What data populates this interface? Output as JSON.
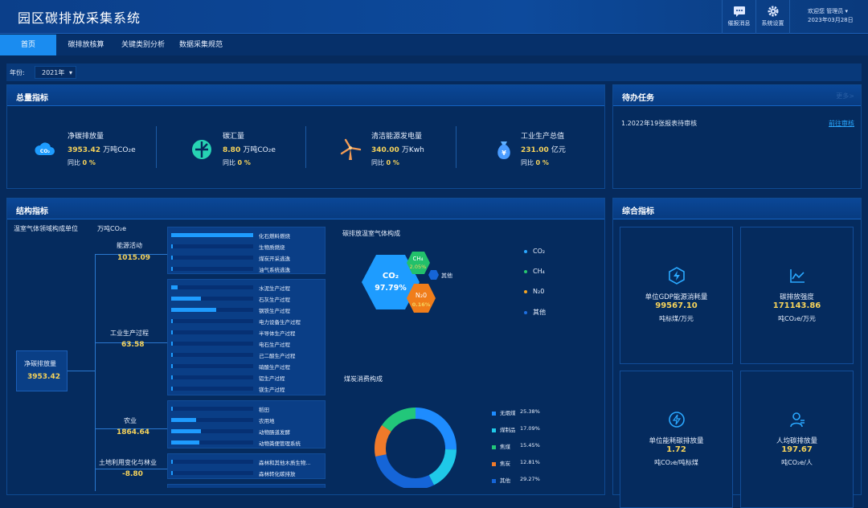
{
  "header": {
    "title": "园区碳排放采集系统",
    "todo_msg_label": "催报消息",
    "settings_label": "系统设置",
    "welcome": "欢迎您",
    "user": "管理员",
    "date": "2023年03月28日"
  },
  "nav": {
    "tabs": [
      "首页",
      "碳排放核算",
      "关键类别分析",
      "数据采集规范"
    ]
  },
  "filter": {
    "year_label": "年份:",
    "year_value": "2021年"
  },
  "total": {
    "title": "总量指标",
    "items": [
      {
        "icon": "co2-cloud-icon",
        "label": "净碳排放量",
        "value": "3953.42",
        "unit": "万吨CO₂e",
        "yoy_label": "同比",
        "yoy": "0 %"
      },
      {
        "icon": "carbon-sink-icon",
        "label": "碳汇量",
        "value": "8.80",
        "unit": "万吨CO₂e",
        "yoy_label": "同比",
        "yoy": "0 %"
      },
      {
        "icon": "wind-turbine-icon",
        "label": "清洁能源发电量",
        "value": "340.00",
        "unit": "万Kwh",
        "yoy_label": "同比",
        "yoy": "0 %"
      },
      {
        "icon": "money-bag-icon",
        "label": "工业生产总值",
        "value": "231.00",
        "unit": "亿元",
        "yoy_label": "同比",
        "yoy": "0 %"
      }
    ]
  },
  "todo": {
    "title": "待办任务",
    "more": "更多>",
    "items": [
      {
        "text": "1.2022年19张报表待审核",
        "action": "前往审核"
      }
    ]
  },
  "structure": {
    "title": "结构指标",
    "caption": "温室气体领域构成单位",
    "unit": "万吨CO₂e",
    "root": {
      "label": "净碳排放量",
      "value": "3953.42"
    },
    "groups": [
      {
        "label": "能源活动",
        "value": "1015.09",
        "bars": [
          {
            "label": "化石燃料燃烧",
            "v": 1.0
          },
          {
            "label": "生物质燃烧",
            "v": 0.0
          },
          {
            "label": "煤炭开采逃逸",
            "v": 0.01
          },
          {
            "label": "油气系统逃逸",
            "v": 0.01
          }
        ]
      },
      {
        "label": "工业生产过程",
        "value": "63.58",
        "bars": [
          {
            "label": "水泥生产过程",
            "v": 0.08
          },
          {
            "label": "石灰生产过程",
            "v": 0.36
          },
          {
            "label": "钢铁生产过程",
            "v": 0.55
          },
          {
            "label": "电力设备生产过程",
            "v": 0.0
          },
          {
            "label": "半导体生产过程",
            "v": 0.0
          },
          {
            "label": "电石生产过程",
            "v": 0.0
          },
          {
            "label": "己二酸生产过程",
            "v": 0.0
          },
          {
            "label": "硝酸生产过程",
            "v": 0.0
          },
          {
            "label": "铝生产过程",
            "v": 0.0
          },
          {
            "label": "镁生产过程",
            "v": 0.0
          }
        ]
      },
      {
        "label": "农业",
        "value": "1864.64",
        "bars": [
          {
            "label": "稻田",
            "v": 0.0
          },
          {
            "label": "农用地",
            "v": 0.3
          },
          {
            "label": "动物肠道发酵",
            "v": 0.36
          },
          {
            "label": "动物粪便管理系统",
            "v": 0.34
          }
        ]
      },
      {
        "label": "土地利用变化与林业",
        "value": "-8.80",
        "bars": [
          {
            "label": "森林和其他木质生物...",
            "v": 0.0
          },
          {
            "label": "森林转化碳排放",
            "v": 0.0
          }
        ]
      }
    ],
    "gas": {
      "title": "碳排放温室气体构成",
      "hex": [
        {
          "name": "CO₂",
          "pct": "97.79%"
        },
        {
          "name": "CH₄",
          "pct": "2.05%"
        },
        {
          "name": "N₂0",
          "pct": "0.16%"
        },
        {
          "name": "其他",
          "pct": ""
        }
      ],
      "legend": [
        {
          "name": "CO₂",
          "color": "#2aa8ff"
        },
        {
          "name": "CH₄",
          "color": "#28c76f"
        },
        {
          "name": "N₂0",
          "color": "#f6a623"
        },
        {
          "name": "其他",
          "color": "#1e6fe0"
        }
      ]
    },
    "coal": {
      "title": "煤炭消费构成",
      "segments": [
        {
          "name": "无烟煤",
          "pct": "25.38%",
          "value": 25.38,
          "color": "#1e8cff"
        },
        {
          "name": "煤制品",
          "pct": "17.09%",
          "value": 17.09,
          "color": "#1fc9e8"
        },
        {
          "name": "焦煤",
          "pct": "15.45%",
          "value": 15.45,
          "color": "#22c77a"
        },
        {
          "name": "焦炭",
          "pct": "12.81%",
          "value": 12.81,
          "color": "#f07a2a"
        },
        {
          "name": "其他",
          "pct": "29.27%",
          "value": 29.27,
          "color": "#1565d8"
        }
      ]
    }
  },
  "composite": {
    "title": "综合指标",
    "cards": [
      {
        "icon": "lightning-hex-icon",
        "label": "单位GDP能源消耗量",
        "value": "99567.10",
        "unit": "吨标煤/万元"
      },
      {
        "icon": "line-chart-icon",
        "label": "碳排放强度",
        "value": "171143.86",
        "unit": "吨CO₂e/万元"
      },
      {
        "icon": "energy-circle-icon",
        "label": "单位能耗碳排放量",
        "value": "1.72",
        "unit": "吨CO₂e/吨标煤"
      },
      {
        "icon": "person-icon",
        "label": "人均碳排放量",
        "value": "197.67",
        "unit": "吨CO₂e/人"
      }
    ]
  }
}
